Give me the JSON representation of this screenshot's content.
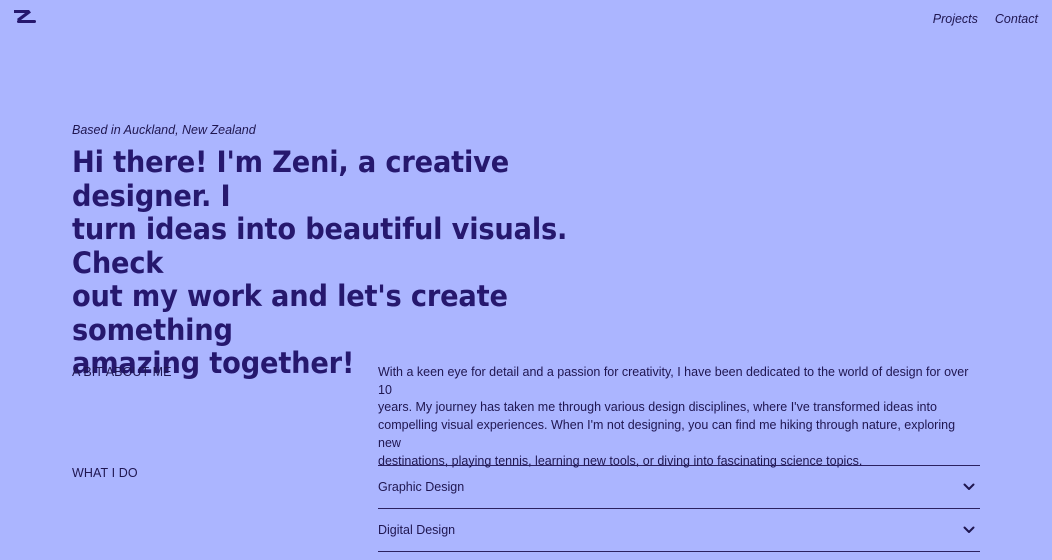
{
  "header": {
    "logo_icon": "z-logo-icon",
    "nav": [
      {
        "label": "Projects"
      },
      {
        "label": "Contact"
      }
    ]
  },
  "hero": {
    "location": "Based in Auckland, New Zealand",
    "headline_lines": [
      "Hi there! I'm Zeni, a creative designer. I",
      "turn ideas into beautiful visuals. Check",
      "out my work and let's create something",
      "amazing together!"
    ]
  },
  "about": {
    "label": "A BIT ABOUT ME",
    "text_lines": [
      "With a keen eye for detail and a passion for creativity, I have been dedicated to the world of design for over 10",
      "years. My journey has taken me through various design disciplines, where I've transformed ideas into",
      "compelling visual experiences. When I'm not designing, you can find me hiking through nature, exploring new",
      "destinations, playing tennis, learning new tools, or diving into fascinating science topics."
    ]
  },
  "services": {
    "label": "WHAT I DO",
    "items": [
      {
        "label": "Graphic Design",
        "icon": "chevron-down-icon"
      },
      {
        "label": "Digital Design",
        "icon": "chevron-down-icon"
      }
    ]
  },
  "colors": {
    "background": "#abb5ff",
    "text": "#26186e"
  }
}
